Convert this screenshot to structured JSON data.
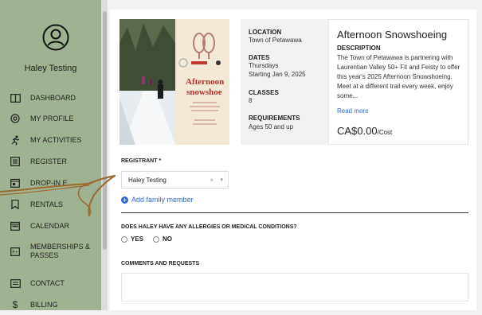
{
  "user": {
    "name": "Haley Testing"
  },
  "nav": [
    {
      "label": "DASHBOARD",
      "icon": "book-icon"
    },
    {
      "label": "MY PROFILE",
      "icon": "at-icon"
    },
    {
      "label": "MY ACTIVITIES",
      "icon": "runner-icon"
    },
    {
      "label": "REGISTER",
      "icon": "list-icon"
    },
    {
      "label": "DROP-IN E",
      "icon": "calendar-day-icon"
    },
    {
      "label": "RENTALS",
      "icon": "bookmark-icon"
    },
    {
      "label": "CALENDAR",
      "icon": "calendar-icon"
    },
    {
      "label": "MEMBERSHIPS & PASSES",
      "icon": "id-card-icon"
    },
    {
      "label": "CONTACT",
      "icon": "message-icon"
    },
    {
      "label": "BILLING",
      "icon": "dollar-icon"
    }
  ],
  "poster": {
    "title_line1": "Afternoon",
    "title_line2": "snowshoe"
  },
  "info": {
    "location_label": "LOCATION",
    "location_value": "Town of Petawawa",
    "dates_label": "DATES",
    "dates_value1": "Thursdays",
    "dates_value2": "Starting Jan 9, 2025",
    "classes_label": "CLASSES",
    "classes_value": "8",
    "requirements_label": "REQUIREMENTS",
    "requirements_value": "Ages 50 and up"
  },
  "details": {
    "title": "Afternoon Snowshoeing",
    "description_label": "DESCRIPTION",
    "description": "The Town of Petawawa is partnering with Laurentian Valley 50+ Fit and Feisty to offer this year's 2025 Afternoon Snowshoeing.  Meet at a different trail every week, enjoy some...",
    "read_more": "Read more",
    "price": "CA$0.00",
    "price_suffix": "/Cost"
  },
  "form": {
    "registrant_label": "REGISTRANT *",
    "registrant_value": "Haley Testing",
    "clear_symbol": "×",
    "add_family": "Add family member",
    "allergy_question": "DOES HALEY HAVE ANY ALLERGIES OR MEDICAL CONDITIONS?",
    "yes": "YES",
    "no": "NO",
    "comments_label": "COMMENTS AND REQUESTS"
  },
  "colors": {
    "sidebar": "#9fb291",
    "accent": "#2d6ad6",
    "arrow": "#9a6a2e"
  }
}
